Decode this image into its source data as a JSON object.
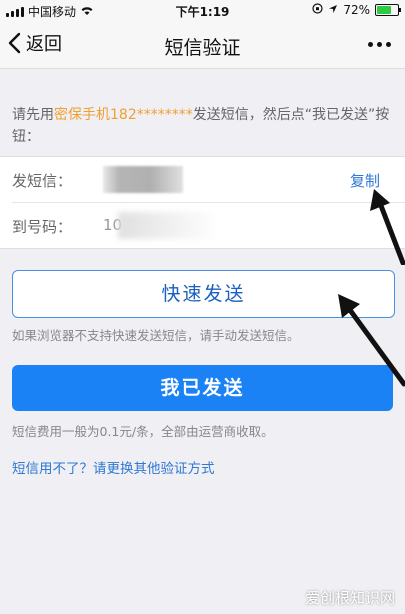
{
  "status_bar": {
    "carrier": "中国移动",
    "time": "下午1:19",
    "battery_percent": "72%",
    "battery_level": 0.72
  },
  "nav": {
    "back_label": "返回",
    "title": "短信验证"
  },
  "instruction": {
    "prefix": "请先用",
    "highlight": "密保手机182********",
    "suffix": "发送短信，然后点“我已发送”按钮："
  },
  "form": {
    "send_label": "发短信：",
    "copy_label": "复制",
    "to_label": "到号码：",
    "to_value": "10"
  },
  "buttons": {
    "quick_send": "快速发送",
    "already_sent": "我已发送"
  },
  "hints": {
    "browser_hint": "如果浏览器不支持快速发送短信，请手动发送短信。",
    "fee_hint": "短信费用一般为0.1元/条，全部由运营商收取。",
    "alt_method": "短信用不了？请更换其他验证方式"
  },
  "watermark": "爱创根知识网",
  "colors": {
    "accent": "#1a82f5",
    "highlight": "#f0a030",
    "link": "#2f78d4"
  }
}
